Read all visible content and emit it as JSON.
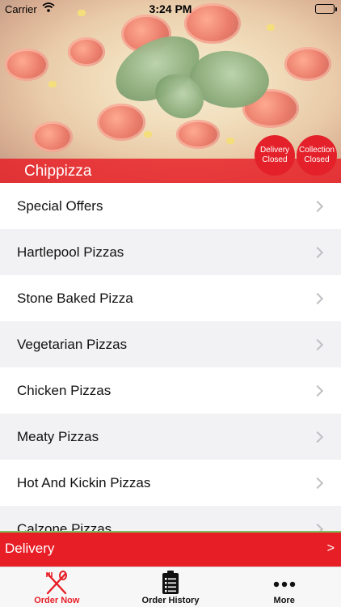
{
  "status_bar": {
    "carrier": "Carrier",
    "time": "3:24 PM"
  },
  "restaurant": {
    "name": "Chippizza",
    "delivery_status": [
      "Delivery",
      "Closed"
    ],
    "collection_status": [
      "Collection",
      "Closed"
    ]
  },
  "menu": {
    "items": [
      {
        "label": "Special Offers"
      },
      {
        "label": "Hartlepool Pizzas"
      },
      {
        "label": "Stone Baked Pizza"
      },
      {
        "label": "Vegetarian Pizzas"
      },
      {
        "label": "Chicken Pizzas"
      },
      {
        "label": "Meaty Pizzas"
      },
      {
        "label": "Hot And Kickin Pizzas"
      },
      {
        "label": "Calzone Pizzas"
      }
    ]
  },
  "delivery_bar": {
    "label": "Delivery",
    "arrow": ">"
  },
  "tab_bar": {
    "tabs": [
      {
        "label": "Order Now",
        "icon": "fork-knife-icon"
      },
      {
        "label": "Order History",
        "icon": "clipboard-list-icon"
      },
      {
        "label": "More",
        "icon": "ellipsis-icon"
      }
    ]
  },
  "colors": {
    "accent": "#e81e26",
    "tab_active": "#e81e26",
    "divider_green": "#7cbf5a"
  }
}
